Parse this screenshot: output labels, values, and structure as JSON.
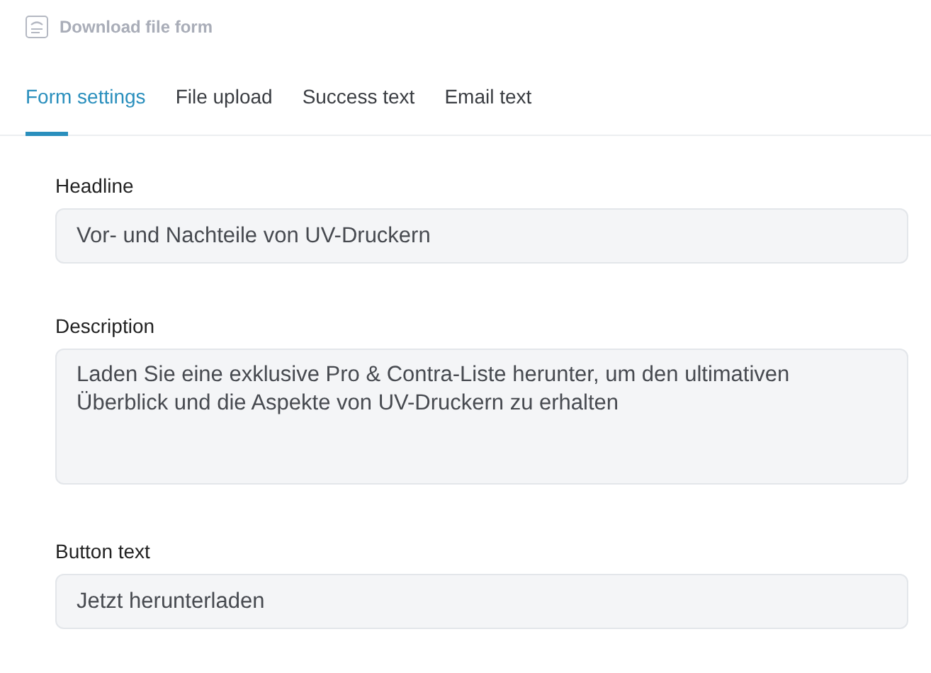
{
  "header": {
    "title": "Download file form"
  },
  "tabs": [
    {
      "label": "Form settings",
      "selected": true
    },
    {
      "label": "File upload",
      "selected": false
    },
    {
      "label": "Success text",
      "selected": false
    },
    {
      "label": "Email text",
      "selected": false
    }
  ],
  "fields": [
    {
      "label": "Headline",
      "kind": "input",
      "value": "Vor- und Nachteile von UV-Druckern"
    },
    {
      "label": "Description",
      "kind": "textarea",
      "value": "Laden Sie eine exklusive Pro & Contra-Liste herunter, um den ultimativen Überblick und die Aspekte von UV-Druckern zu erhalten"
    },
    {
      "label": "Button text",
      "kind": "input",
      "value": "Jetzt herunterladen"
    }
  ]
}
